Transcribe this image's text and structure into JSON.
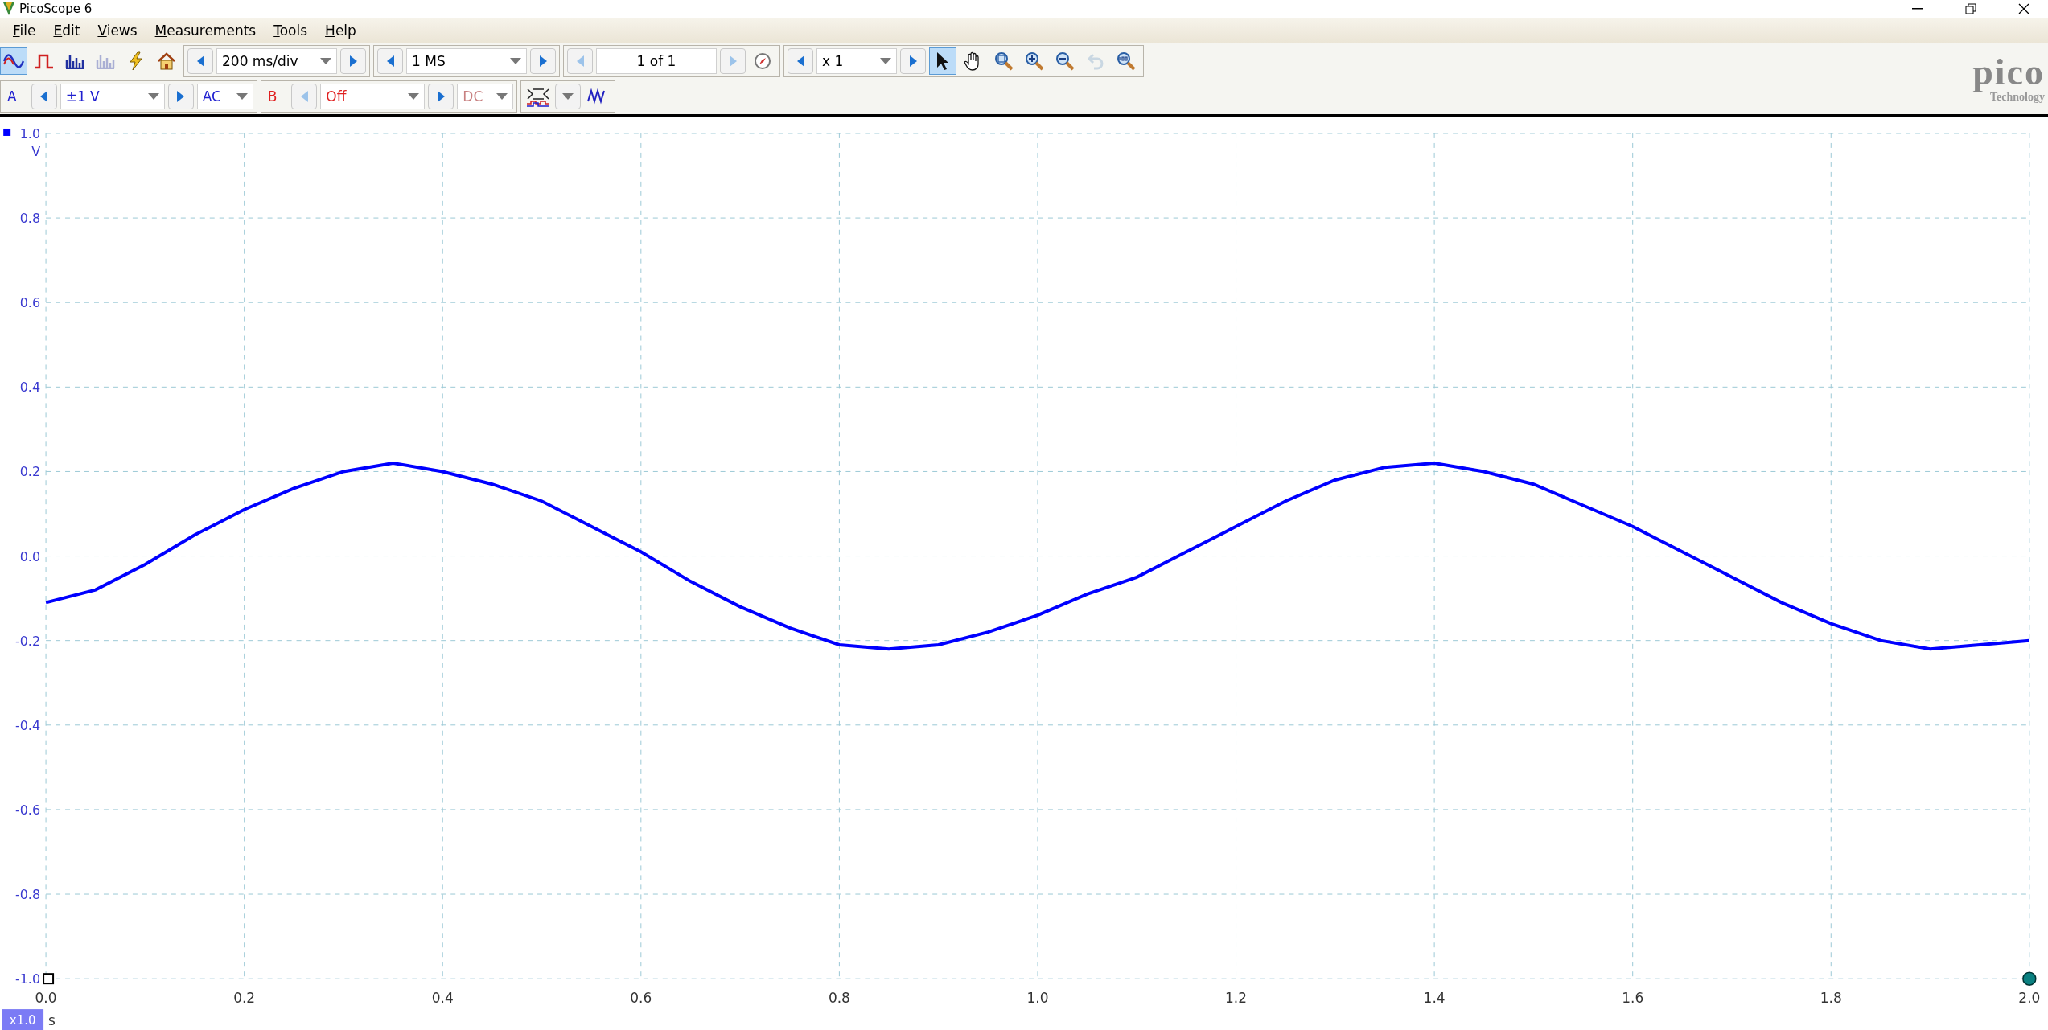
{
  "window": {
    "title": "PicoScope 6"
  },
  "menu": [
    {
      "label": "File"
    },
    {
      "label": "Edit"
    },
    {
      "label": "Views"
    },
    {
      "label": "Measurements"
    },
    {
      "label": "Tools"
    },
    {
      "label": "Help"
    }
  ],
  "modes": [
    {
      "kind": "scope",
      "selected": true,
      "disabled": false
    },
    {
      "kind": "persistence",
      "selected": false,
      "disabled": false
    },
    {
      "kind": "spectrum",
      "selected": false,
      "disabled": false
    },
    {
      "kind": "spectrum",
      "selected": false,
      "disabled": true
    }
  ],
  "timebase": {
    "value": "200 ms/div"
  },
  "samples": {
    "value": "1 MS"
  },
  "buffer": {
    "value": "1 of 1"
  },
  "zoom": {
    "value": "x 1"
  },
  "tools": [
    {
      "kind": "pointer",
      "selected": true,
      "disabled": false
    },
    {
      "kind": "hand",
      "selected": false,
      "disabled": false
    },
    {
      "kind": "zoom-area",
      "selected": false,
      "disabled": false
    },
    {
      "kind": "zoom-in",
      "selected": false,
      "disabled": false
    },
    {
      "kind": "zoom-out",
      "selected": false,
      "disabled": false
    },
    {
      "kind": "undo",
      "selected": false,
      "disabled": true
    },
    {
      "kind": "zoom-100",
      "selected": false,
      "disabled": false
    }
  ],
  "channels": [
    {
      "name": "A",
      "range": "±1 V",
      "coupling": "AC",
      "color": "#2020d0",
      "enabled": true
    },
    {
      "name": "B",
      "range": "Off",
      "coupling": "DC",
      "color": "#e02020",
      "enabled": false
    }
  ],
  "logo": {
    "name": "pico",
    "tagline": "Technology"
  },
  "plot": {
    "scale_badge": "x1.0",
    "chart_data": {
      "type": "line",
      "grid": true,
      "xlabel": "s",
      "ylabel": "V",
      "xlim": [
        0,
        2
      ],
      "ylim": [
        -1,
        1
      ],
      "xticks": [
        {
          "value": 0,
          "label": "0.0"
        },
        {
          "value": 0.2,
          "label": "0.2"
        },
        {
          "value": 0.4,
          "label": "0.4"
        },
        {
          "value": 0.6,
          "label": "0.6"
        },
        {
          "value": 0.8,
          "label": "0.8"
        },
        {
          "value": 1,
          "label": "1.0"
        },
        {
          "value": 1.2,
          "label": "1.2"
        },
        {
          "value": 1.4,
          "label": "1.4"
        },
        {
          "value": 1.6,
          "label": "1.6"
        },
        {
          "value": 1.8,
          "label": "1.8"
        },
        {
          "value": 2,
          "label": "2.0"
        }
      ],
      "yticks": [
        {
          "value": 1,
          "label": "1.0"
        },
        {
          "value": 0.8,
          "label": "0.8"
        },
        {
          "value": 0.6,
          "label": "0.6"
        },
        {
          "value": 0.4,
          "label": "0.4"
        },
        {
          "value": 0.2,
          "label": "0.2"
        },
        {
          "value": 0,
          "label": "0.0"
        },
        {
          "value": -0.2,
          "label": "-0.2"
        },
        {
          "value": -0.4,
          "label": "-0.4"
        },
        {
          "value": -0.6,
          "label": "-0.6"
        },
        {
          "value": -0.8,
          "label": "-0.8"
        },
        {
          "value": -1,
          "label": "-1.0"
        }
      ],
      "x": [
        0,
        0.05,
        0.1,
        0.15,
        0.2,
        0.25,
        0.3,
        0.35,
        0.4,
        0.45,
        0.5,
        0.55,
        0.6,
        0.65,
        0.7,
        0.75,
        0.8,
        0.85,
        0.9,
        0.95,
        1,
        1.05,
        1.1,
        1.15,
        1.2,
        1.25,
        1.3,
        1.35,
        1.4,
        1.45,
        1.5,
        1.55,
        1.6,
        1.65,
        1.7,
        1.75,
        1.8,
        1.85,
        1.9,
        1.95,
        2
      ],
      "series": [
        {
          "color": "#0000ff",
          "values": [
            -0.11,
            -0.08,
            -0.02,
            0.05,
            0.11,
            0.16,
            0.2,
            0.22,
            0.2,
            0.17,
            0.13,
            0.07,
            0.01,
            -0.06,
            -0.12,
            -0.17,
            -0.21,
            -0.22,
            -0.21,
            -0.18,
            -0.14,
            -0.09,
            -0.05,
            0.01,
            0.07,
            0.13,
            0.18,
            0.21,
            0.22,
            0.2,
            0.17,
            0.12,
            0.07,
            0.01,
            -0.05,
            -0.11,
            -0.16,
            -0.2,
            -0.22,
            -0.21,
            -0.2
          ]
        }
      ]
    }
  }
}
